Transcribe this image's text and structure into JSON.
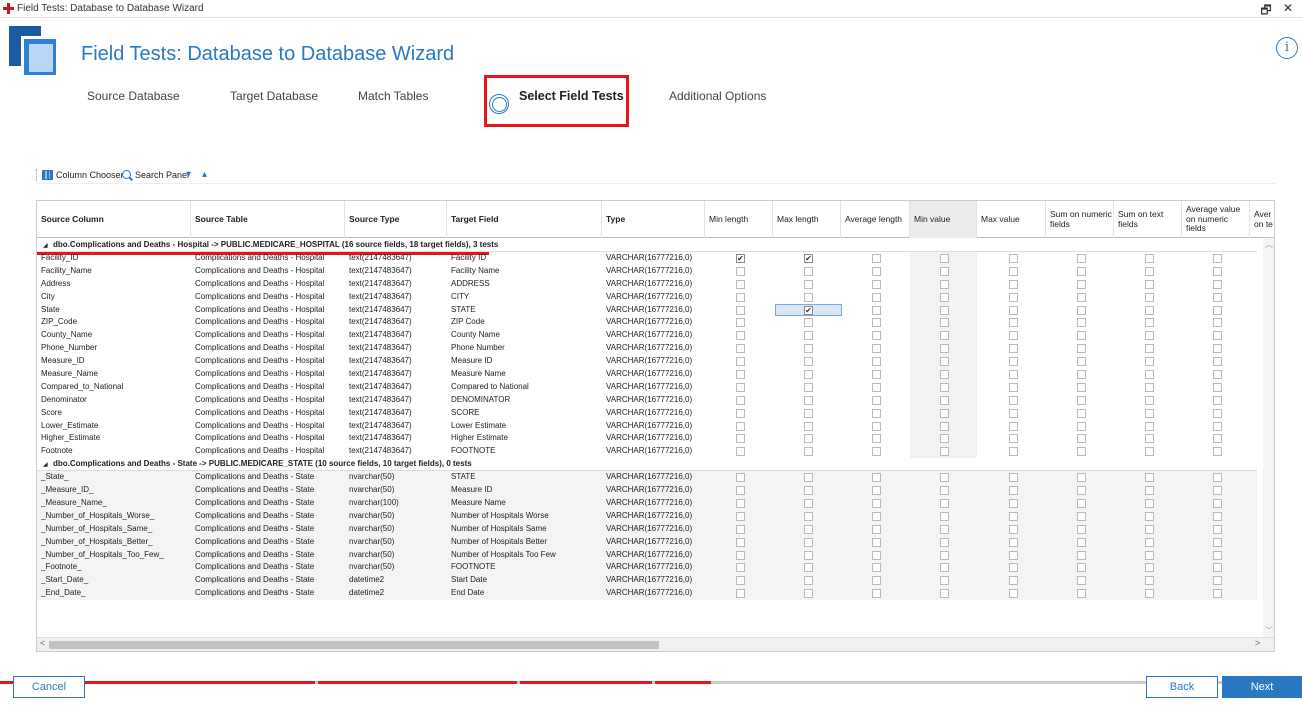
{
  "window": {
    "title": "Field Tests: Database to Database Wizard",
    "controls": {
      "restore": "🗗",
      "close": "✕"
    }
  },
  "header": {
    "title": "Field Tests: Database to Database Wizard",
    "info_icon": "i"
  },
  "steps": [
    {
      "label": "Source Database",
      "active": false
    },
    {
      "label": "Target Database",
      "active": false
    },
    {
      "label": "Match Tables",
      "active": false
    },
    {
      "label": "Select Field Tests",
      "active": true
    },
    {
      "label": "Additional Options",
      "active": false
    }
  ],
  "toolbar": {
    "column_chooser": "Column Chooser",
    "search_panel": "Search Panel",
    "expand_all": "▾",
    "collapse_all": "▴"
  },
  "grid": {
    "columns": [
      "Source Column",
      "Source Table",
      "Source Type",
      "Target Field",
      "Type",
      "Min length",
      "Max length",
      "Average length",
      "Min value",
      "Max value",
      "Sum on numeric fields",
      "Sum on text fields",
      "Average value on numeric fields",
      "Aver on te"
    ],
    "groups": [
      {
        "label": "dbo.Complications and Deaths - Hospital  ->  PUBLIC.MEDICARE_HOSPITAL (16 source fields, 18 target fields), 3 tests",
        "rows": [
          {
            "src": "Facility_ID",
            "table": "Complications and Deaths - Hospital",
            "stype": "text(2147483647)",
            "target": "Facility ID",
            "type": "VARCHAR(16777216,0)",
            "checks": [
              true,
              true,
              false,
              false,
              false,
              false,
              false,
              false
            ]
          },
          {
            "src": "Facility_Name",
            "table": "Complications and Deaths - Hospital",
            "stype": "text(2147483647)",
            "target": "Facility Name",
            "type": "VARCHAR(16777216,0)",
            "checks": [
              false,
              false,
              false,
              false,
              false,
              false,
              false,
              false
            ]
          },
          {
            "src": "Address",
            "table": "Complications and Deaths - Hospital",
            "stype": "text(2147483647)",
            "target": "ADDRESS",
            "type": "VARCHAR(16777216,0)",
            "checks": [
              false,
              false,
              false,
              false,
              false,
              false,
              false,
              false
            ]
          },
          {
            "src": "City",
            "table": "Complications and Deaths - Hospital",
            "stype": "text(2147483647)",
            "target": "CITY",
            "type": "VARCHAR(16777216,0)",
            "checks": [
              false,
              false,
              false,
              false,
              false,
              false,
              false,
              false
            ]
          },
          {
            "src": "State",
            "table": "Complications and Deaths - Hospital",
            "stype": "text(2147483647)",
            "target": "STATE",
            "type": "VARCHAR(16777216,0)",
            "checks": [
              false,
              true,
              false,
              false,
              false,
              false,
              false,
              false
            ]
          },
          {
            "src": "ZIP_Code",
            "table": "Complications and Deaths - Hospital",
            "stype": "text(2147483647)",
            "target": "ZIP Code",
            "type": "VARCHAR(16777216,0)",
            "checks": [
              false,
              false,
              false,
              false,
              false,
              false,
              false,
              false
            ]
          },
          {
            "src": "County_Name",
            "table": "Complications and Deaths - Hospital",
            "stype": "text(2147483647)",
            "target": "County Name",
            "type": "VARCHAR(16777216,0)",
            "checks": [
              false,
              false,
              false,
              false,
              false,
              false,
              false,
              false
            ]
          },
          {
            "src": "Phone_Number",
            "table": "Complications and Deaths - Hospital",
            "stype": "text(2147483647)",
            "target": "Phone Number",
            "type": "VARCHAR(16777216,0)",
            "checks": [
              false,
              false,
              false,
              false,
              false,
              false,
              false,
              false
            ]
          },
          {
            "src": "Measure_ID",
            "table": "Complications and Deaths - Hospital",
            "stype": "text(2147483647)",
            "target": "Measure ID",
            "type": "VARCHAR(16777216,0)",
            "checks": [
              false,
              false,
              false,
              false,
              false,
              false,
              false,
              false
            ]
          },
          {
            "src": "Measure_Name",
            "table": "Complications and Deaths - Hospital",
            "stype": "text(2147483647)",
            "target": "Measure Name",
            "type": "VARCHAR(16777216,0)",
            "checks": [
              false,
              false,
              false,
              false,
              false,
              false,
              false,
              false
            ]
          },
          {
            "src": "Compared_to_National",
            "table": "Complications and Deaths - Hospital",
            "stype": "text(2147483647)",
            "target": "Compared to National",
            "type": "VARCHAR(16777216,0)",
            "checks": [
              false,
              false,
              false,
              false,
              false,
              false,
              false,
              false
            ]
          },
          {
            "src": "Denominator",
            "table": "Complications and Deaths - Hospital",
            "stype": "text(2147483647)",
            "target": "DENOMINATOR",
            "type": "VARCHAR(16777216,0)",
            "checks": [
              false,
              false,
              false,
              false,
              false,
              false,
              false,
              false
            ]
          },
          {
            "src": "Score",
            "table": "Complications and Deaths - Hospital",
            "stype": "text(2147483647)",
            "target": "SCORE",
            "type": "VARCHAR(16777216,0)",
            "checks": [
              false,
              false,
              false,
              false,
              false,
              false,
              false,
              false
            ]
          },
          {
            "src": "Lower_Estimate",
            "table": "Complications and Deaths - Hospital",
            "stype": "text(2147483647)",
            "target": "Lower Estimate",
            "type": "VARCHAR(16777216,0)",
            "checks": [
              false,
              false,
              false,
              false,
              false,
              false,
              false,
              false
            ]
          },
          {
            "src": "Higher_Estimate",
            "table": "Complications and Deaths - Hospital",
            "stype": "text(2147483647)",
            "target": "Higher Estimate",
            "type": "VARCHAR(16777216,0)",
            "checks": [
              false,
              false,
              false,
              false,
              false,
              false,
              false,
              false
            ]
          },
          {
            "src": "Footnote",
            "table": "Complications and Deaths - Hospital",
            "stype": "text(2147483647)",
            "target": "FOOTNOTE",
            "type": "VARCHAR(16777216,0)",
            "checks": [
              false,
              false,
              false,
              false,
              false,
              false,
              false,
              false
            ]
          }
        ]
      },
      {
        "label": "dbo.Complications and Deaths - State  ->  PUBLIC.MEDICARE_STATE (10 source fields, 10 target fields), 0 tests",
        "rows": [
          {
            "src": "_State_",
            "table": "Complications and Deaths - State",
            "stype": "nvarchar(50)",
            "target": "STATE",
            "type": "VARCHAR(16777216,0)",
            "checks": [
              false,
              false,
              false,
              false,
              false,
              false,
              false,
              false
            ]
          },
          {
            "src": "_Measure_ID_",
            "table": "Complications and Deaths - State",
            "stype": "nvarchar(50)",
            "target": "Measure ID",
            "type": "VARCHAR(16777216,0)",
            "checks": [
              false,
              false,
              false,
              false,
              false,
              false,
              false,
              false
            ]
          },
          {
            "src": "_Measure_Name_",
            "table": "Complications and Deaths - State",
            "stype": "nvarchar(100)",
            "target": "Measure Name",
            "type": "VARCHAR(16777216,0)",
            "checks": [
              false,
              false,
              false,
              false,
              false,
              false,
              false,
              false
            ]
          },
          {
            "src": "_Number_of_Hospitals_Worse_",
            "table": "Complications and Deaths - State",
            "stype": "nvarchar(50)",
            "target": "Number of Hospitals Worse",
            "type": "VARCHAR(16777216,0)",
            "checks": [
              false,
              false,
              false,
              false,
              false,
              false,
              false,
              false
            ]
          },
          {
            "src": "_Number_of_Hospitals_Same_",
            "table": "Complications and Deaths - State",
            "stype": "nvarchar(50)",
            "target": "Number of Hospitals Same",
            "type": "VARCHAR(16777216,0)",
            "checks": [
              false,
              false,
              false,
              false,
              false,
              false,
              false,
              false
            ]
          },
          {
            "src": "_Number_of_Hospitals_Better_",
            "table": "Complications and Deaths - State",
            "stype": "nvarchar(50)",
            "target": "Number of Hospitals Better",
            "type": "VARCHAR(16777216,0)",
            "checks": [
              false,
              false,
              false,
              false,
              false,
              false,
              false,
              false
            ]
          },
          {
            "src": "_Number_of_Hospitals_Too_Few_",
            "table": "Complications and Deaths - State",
            "stype": "nvarchar(50)",
            "target": "Number of Hospitals Too Few",
            "type": "VARCHAR(16777216,0)",
            "checks": [
              false,
              false,
              false,
              false,
              false,
              false,
              false,
              false
            ]
          },
          {
            "src": "_Footnote_",
            "table": "Complications and Deaths - State",
            "stype": "nvarchar(50)",
            "target": "FOOTNOTE",
            "type": "VARCHAR(16777216,0)",
            "checks": [
              false,
              false,
              false,
              false,
              false,
              false,
              false,
              false
            ]
          },
          {
            "src": "_Start_Date_",
            "table": "Complications and Deaths - State",
            "stype": "datetime2",
            "target": "Start Date",
            "type": "VARCHAR(16777216,0)",
            "checks": [
              false,
              false,
              false,
              false,
              false,
              false,
              false,
              false
            ]
          },
          {
            "src": "_End_Date_",
            "table": "Complications and Deaths - State",
            "stype": "datetime2",
            "target": "End Date",
            "type": "VARCHAR(16777216,0)",
            "checks": [
              false,
              false,
              false,
              false,
              false,
              false,
              false,
              false
            ]
          }
        ]
      }
    ]
  },
  "footer": {
    "cancel": "Cancel",
    "back": "Back",
    "next": "Next"
  },
  "colors": {
    "accent": "#2a78c2",
    "annotation_red": "#e8141c"
  }
}
